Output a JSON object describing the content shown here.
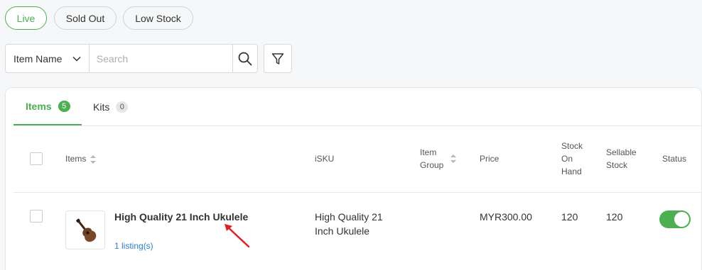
{
  "filters": {
    "live": "Live",
    "sold_out": "Sold Out",
    "low_stock": "Low Stock"
  },
  "search": {
    "field_selected": "Item Name",
    "placeholder": "Search"
  },
  "tabs": [
    {
      "label": "Items",
      "count": "5"
    },
    {
      "label": "Kits",
      "count": "0"
    }
  ],
  "table": {
    "headers": {
      "items": "Items",
      "isku": "iSKU",
      "item_group_1": "Item",
      "item_group_2": "Group",
      "price": "Price",
      "stock_on_hand_1": "Stock",
      "stock_on_hand_2": "On",
      "stock_on_hand_3": "Hand",
      "sellable_1": "Sellable",
      "sellable_2": "Stock",
      "status": "Status"
    },
    "rows": [
      {
        "name": "High Quality 21 Inch Ukulele",
        "listings": "1 listing(s)",
        "isku_1": "High Quality 21",
        "isku_2": "Inch Ukulele",
        "item_group": "",
        "price": "MYR300.00",
        "stock_on_hand": "120",
        "sellable_stock": "120",
        "status_on": true
      }
    ]
  },
  "colors": {
    "accent": "#4caf50",
    "link": "#2d7fd3",
    "annotation_arrow": "#e02020"
  }
}
